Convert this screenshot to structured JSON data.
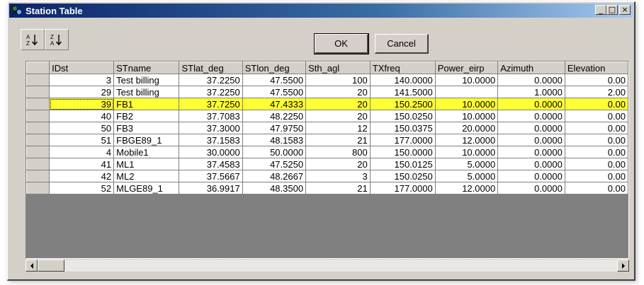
{
  "window": {
    "title": "Station Table",
    "icon": "station-app-icon",
    "controls": {
      "minimize": "_",
      "maximize": "□",
      "close": "×"
    }
  },
  "toolbar": {
    "sort_ascending_icon": "sort-ascending-icon",
    "sort_descending_icon": "sort-descending-icon"
  },
  "buttons": {
    "ok": "OK",
    "cancel": "Cancel"
  },
  "table": {
    "columns": [
      "IDst",
      "STname",
      "STlat_deg",
      "STlon_deg",
      "Sth_agl",
      "TXfreq",
      "Power_eirp",
      "Azimuth",
      "Elevation"
    ],
    "selected_row_index": 2,
    "rows": [
      [
        "3",
        "Test billing",
        "37.2250",
        "47.5500",
        "100",
        "140.0000",
        "10.0000",
        "0.0000",
        "0.00"
      ],
      [
        "29",
        "Test billing",
        "37.2250",
        "47.5500",
        "20",
        "141.5000",
        "",
        "1.0000",
        "2.00"
      ],
      [
        "39",
        "FB1",
        "37.7250",
        "47.4333",
        "20",
        "150.2500",
        "10.0000",
        "0.0000",
        "0.00"
      ],
      [
        "40",
        "FB2",
        "37.7083",
        "48.2250",
        "20",
        "150.0250",
        "10.0000",
        "0.0000",
        "0.00"
      ],
      [
        "50",
        "FB3",
        "37.3000",
        "47.9750",
        "12",
        "150.0375",
        "20.0000",
        "0.0000",
        "0.00"
      ],
      [
        "51",
        "FBGE89_1",
        "37.1583",
        "48.1583",
        "21",
        "177.0000",
        "12.0000",
        "0.0000",
        "0.00"
      ],
      [
        "4",
        "Mobile1",
        "30.0000",
        "50.0000",
        "800",
        "150.0000",
        "10.0000",
        "0.0000",
        "0.00"
      ],
      [
        "41",
        "ML1",
        "37.4583",
        "47.5250",
        "20",
        "150.0125",
        "5.0000",
        "0.0000",
        "0.00"
      ],
      [
        "42",
        "ML2",
        "37.5667",
        "48.2667",
        "3",
        "150.0250",
        "5.0000",
        "0.0000",
        "0.00"
      ],
      [
        "52",
        "MLGE89_1",
        "36.9917",
        "48.3500",
        "21",
        "177.0000",
        "12.0000",
        "0.0000",
        "0.00"
      ]
    ]
  },
  "colors": {
    "highlight_row": "#ffff33",
    "face": "#d4d0c8",
    "titlebar": "#0a246a"
  }
}
